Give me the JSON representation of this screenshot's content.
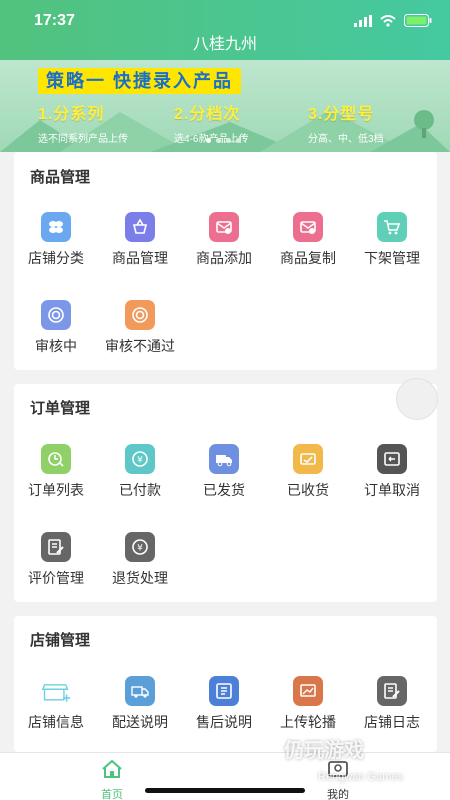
{
  "status": {
    "time": "17:37"
  },
  "app": {
    "title": "八桂九州"
  },
  "banner": {
    "title": "策略一  快捷录入产品",
    "steps": [
      {
        "title": "1.分系列",
        "desc": "选不同系列产品上传"
      },
      {
        "title": "2.分档次",
        "desc": "选4-6款产品上传"
      },
      {
        "title": "3.分型号",
        "desc": "分高、中、低3档"
      }
    ]
  },
  "sections": [
    {
      "title": "商品管理",
      "items": [
        {
          "label": "店铺分类",
          "icon": "category-icon",
          "color": "#6aa9f0"
        },
        {
          "label": "商品管理",
          "icon": "basket-icon",
          "color": "#7b7ee8"
        },
        {
          "label": "商品添加",
          "icon": "product-add-icon",
          "color": "#ec6f8f"
        },
        {
          "label": "商品复制",
          "icon": "product-copy-icon",
          "color": "#ec6f8f"
        },
        {
          "label": "下架管理",
          "icon": "cart-icon",
          "color": "#5fd0b7"
        },
        {
          "label": "审核中",
          "icon": "review-pending-icon",
          "color": "#7d97e8"
        },
        {
          "label": "审核不通过",
          "icon": "review-rejected-icon",
          "color": "#f19a5b"
        }
      ]
    },
    {
      "title": "订单管理",
      "items": [
        {
          "label": "订单列表",
          "icon": "order-list-icon",
          "color": "#8fd168"
        },
        {
          "label": "已付款",
          "icon": "paid-icon",
          "color": "#5ec8c8"
        },
        {
          "label": "已发货",
          "icon": "truck-icon",
          "color": "#6f8fe0"
        },
        {
          "label": "已收货",
          "icon": "received-icon",
          "color": "#f2b84a"
        },
        {
          "label": "订单取消",
          "icon": "order-cancel-icon",
          "color": "#555555"
        },
        {
          "label": "评价管理",
          "icon": "review-edit-icon",
          "color": "#666666"
        },
        {
          "label": "退货处理",
          "icon": "refund-icon",
          "color": "#666666"
        }
      ]
    },
    {
      "title": "店铺管理",
      "items": [
        {
          "label": "店铺信息",
          "icon": "store-add-icon",
          "color": "#6fd0e0"
        },
        {
          "label": "配送说明",
          "icon": "delivery-icon",
          "color": "#5b9fd8"
        },
        {
          "label": "售后说明",
          "icon": "after-sale-icon",
          "color": "#4b7fd8"
        },
        {
          "label": "上传轮播",
          "icon": "upload-banner-icon",
          "color": "#d9764a"
        },
        {
          "label": "店铺日志",
          "icon": "store-log-icon",
          "color": "#666666"
        }
      ]
    }
  ],
  "tabs": [
    {
      "label": "首页",
      "icon": "home-icon",
      "active": true
    },
    {
      "label": "我的",
      "icon": "profile-icon",
      "active": false
    }
  ],
  "colors": {
    "brand": "#4cc37c",
    "tab_active": "#4cc37c",
    "tab_inactive": "#333333"
  },
  "watermark": {
    "text": "仍玩游戏",
    "sub": "Rengwan Games"
  }
}
